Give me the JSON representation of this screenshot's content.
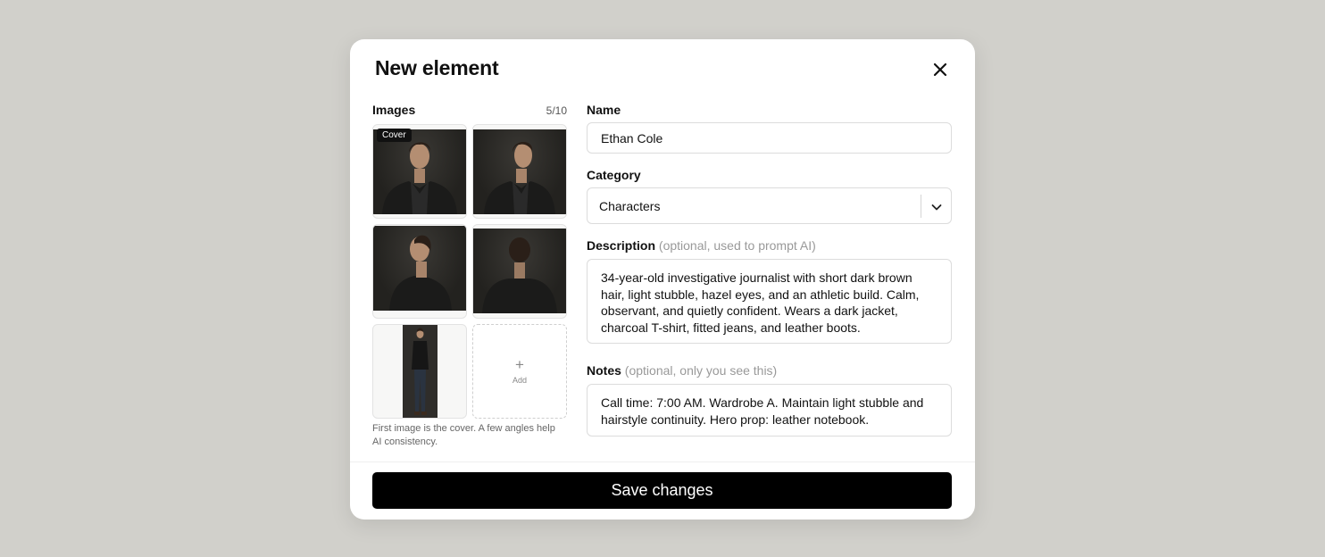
{
  "dialog": {
    "title": "New element",
    "close_icon": "close-icon"
  },
  "images": {
    "label": "Images",
    "count": "5/10",
    "cover_badge": "Cover",
    "add_label": "Add",
    "add_icon": "plus-icon",
    "hint": "First image is the cover. A few angles help AI consistency."
  },
  "name": {
    "label": "Name",
    "value": "Ethan Cole"
  },
  "category": {
    "label": "Category",
    "selected": "Characters",
    "chevron_icon": "chevron-down-icon"
  },
  "description": {
    "label": "Description",
    "optional": "(optional, used to prompt AI)",
    "value": "34-year-old investigative journalist with short dark brown hair, light stubble, hazel eyes, and an athletic build. Calm, observant, and quietly confident. Wears a dark jacket, charcoal T-shirt, fitted jeans, and leather boots."
  },
  "notes": {
    "label": "Notes",
    "optional": "(optional, only you see this)",
    "value": "Call time: 7:00 AM. Wardrobe A. Maintain light stubble and hairstyle continuity. Hero prop: leather notebook."
  },
  "footer": {
    "save_label": "Save changes"
  },
  "colors": {
    "backdrop": "#d1d0cb",
    "primary_button": "#000000",
    "muted_text": "#999999"
  }
}
